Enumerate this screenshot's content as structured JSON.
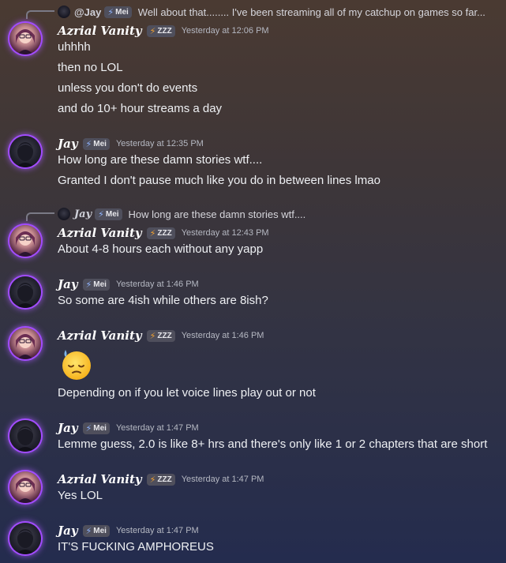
{
  "messages": [
    {
      "reply": {
        "user": "@Jay",
        "tag": "Mei",
        "text": "Well about that........ I've been streaming all of my catchup on games so far..."
      },
      "user": "Azrial Vanity",
      "tag": "ZZZ",
      "time": "Yesterday at 12:06 PM",
      "lines": [
        "uhhhh",
        "then no LOL",
        "unless you don't do events",
        "and do 10+ hour streams a day"
      ]
    },
    {
      "user": "Jay",
      "tag": "Mei",
      "time": "Yesterday at 12:35 PM",
      "lines": [
        "How long are these damn stories wtf....",
        "Granted I don't pause much like you do in between lines lmao"
      ]
    },
    {
      "reply": {
        "user": "Jay",
        "tag": "Mei",
        "text": "How long are these damn stories wtf...."
      },
      "user": "Azrial Vanity",
      "tag": "ZZZ",
      "time": "Yesterday at 12:43 PM",
      "lines": [
        "About 4-8 hours each without any yapp"
      ]
    },
    {
      "user": "Jay",
      "tag": "Mei",
      "time": "Yesterday at 1:46 PM",
      "lines": [
        "So some are 4ish while others are 8ish?"
      ]
    },
    {
      "user": "Azrial Vanity",
      "tag": "ZZZ",
      "time": "Yesterday at 1:46 PM",
      "emoji": "downcast-face-with-sweat",
      "lines": [
        "Depending on if you let voice lines play out or not"
      ]
    },
    {
      "user": "Jay",
      "tag": "Mei",
      "time": "Yesterday at 1:47 PM",
      "lines": [
        "Lemme guess, 2.0 is like 8+ hrs and there's only like 1 or 2 chapters that are short"
      ]
    },
    {
      "user": "Azrial Vanity",
      "tag": "ZZZ",
      "time": "Yesterday at 1:47 PM",
      "lines": [
        "Yes LOL"
      ]
    },
    {
      "user": "Jay",
      "tag": "Mei",
      "time": "Yesterday at 1:47 PM",
      "lines": [
        "IT'S FUCKING AMPHOREUS"
      ]
    }
  ],
  "colors": {
    "tag_bolt_zzz": "#f0a030",
    "tag_bolt_mei": "#8fb4ff",
    "avatar_ring": "#a24cff"
  }
}
